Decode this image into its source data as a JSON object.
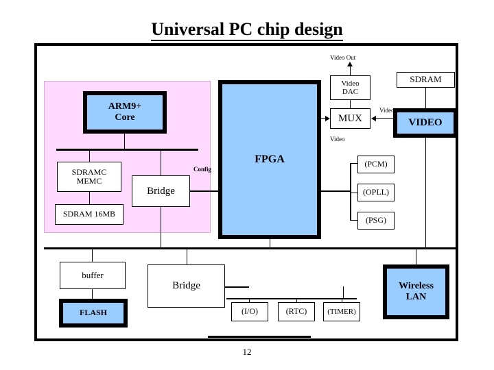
{
  "slide": {
    "title": "Universal PC chip design",
    "page_number": "12"
  },
  "blocks": {
    "arm_core": "ARM9+\nCore",
    "sdramc_memc": "SDRAMC\nMEMC",
    "sdram_16mb": "SDRAM 16MB",
    "bridge_top": "Bridge",
    "fpga": "FPGA",
    "video_dac": "Video\nDAC",
    "mux": "MUX",
    "sdram": "SDRAM",
    "video": "VIDEO",
    "pcm": "(PCM)",
    "opll": "(OPLL)",
    "psg": "(PSG)",
    "buffer": "buffer",
    "flash": "FLASH",
    "bridge_bottom": "Bridge",
    "io": "(I/O)",
    "rtc": "(RTC)",
    "timer": "(TIMER)",
    "wireless_lan": "Wireless\nLAN"
  },
  "labels": {
    "video_out": "Video Out",
    "config": "Config",
    "video_right": "Video",
    "video_left": "Video"
  },
  "colors": {
    "chip_blue": "#99ccff",
    "chip_region_pink": "#ffd9ff",
    "outline": "#000000",
    "background": "#ffffff"
  }
}
